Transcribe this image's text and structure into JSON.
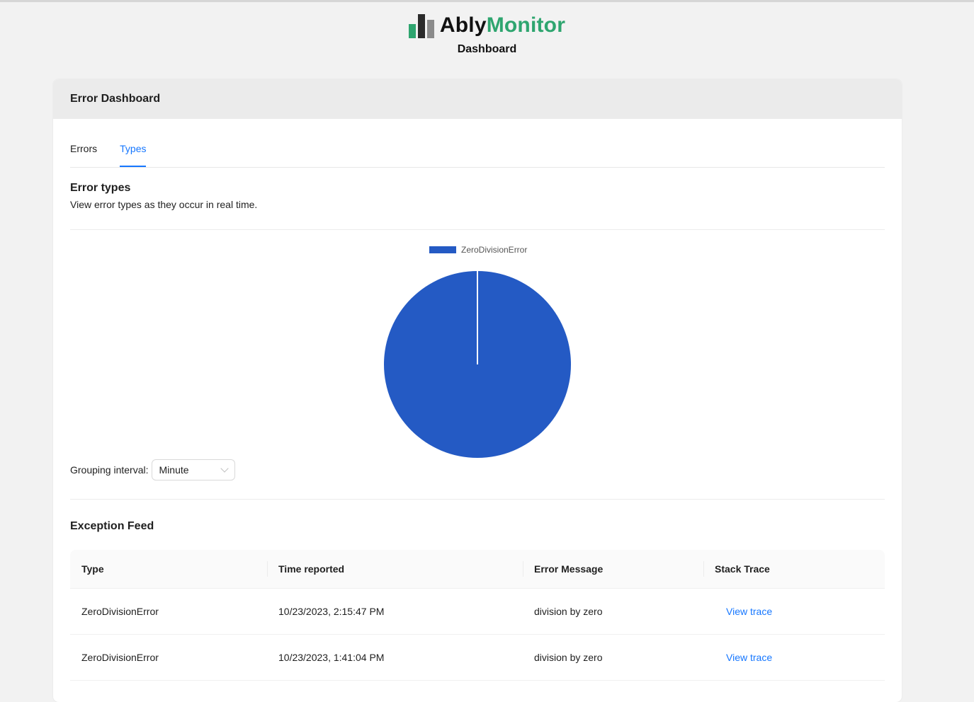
{
  "brand": {
    "name_part1": "Ably",
    "name_part2": "Monitor",
    "subtitle": "Dashboard",
    "colors": {
      "green": "#2ea56f",
      "dark": "#111111"
    }
  },
  "card": {
    "title": "Error Dashboard",
    "tabs": [
      {
        "label": "Errors",
        "active": false
      },
      {
        "label": "Types",
        "active": true
      }
    ]
  },
  "section": {
    "title": "Error types",
    "description": "View error types as they occur in real time."
  },
  "chart_data": {
    "type": "pie",
    "labels": [
      "ZeroDivisionError"
    ],
    "values": [
      100
    ],
    "colors": [
      "#245ac4"
    ],
    "legend_position": "top"
  },
  "grouping": {
    "label": "Grouping interval:",
    "selected": "Minute"
  },
  "feed": {
    "title": "Exception Feed",
    "columns": [
      "Type",
      "Time reported",
      "Error Message",
      "Stack Trace"
    ],
    "rows": [
      {
        "type": "ZeroDivisionError",
        "time": "10/23/2023, 2:15:47 PM",
        "message": "division by zero",
        "trace": "View trace"
      },
      {
        "type": "ZeroDivisionError",
        "time": "10/23/2023, 1:41:04 PM",
        "message": "division by zero",
        "trace": "View trace"
      }
    ]
  }
}
